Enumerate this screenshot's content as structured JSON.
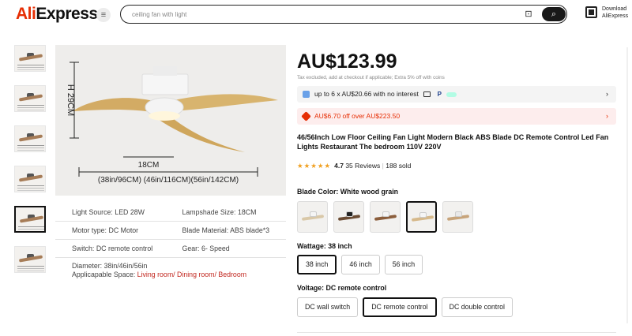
{
  "header": {
    "logo_ali": "Ali",
    "logo_express": "Express",
    "search_value": "ceiling fan with light",
    "download_line1": "Download",
    "download_line2": "AliExpress"
  },
  "gallery": {
    "thumb_count": 6,
    "active_thumb": 5,
    "image_labels": {
      "height": "H 29CM",
      "width": "18CM",
      "sizes": "(38in/96CM) (46in/116CM)(56in/142CM)"
    }
  },
  "specs": {
    "rows": [
      {
        "a": "Light Source:",
        "av": "LED 28W",
        "b": "Lampshade Size:",
        "bv": "18CM"
      },
      {
        "a": "Motor type:",
        "av": "DC Motor",
        "b": "Blade Material:",
        "bv": "ABS blade*3"
      },
      {
        "a": "Switch:",
        "av": "DC remote control",
        "b": "Gear:",
        "bv": "6- Speed"
      }
    ],
    "diameter_label": "Diameter:",
    "diameter_value": "38in/46in/56in",
    "space_label": "Applicapable Space:",
    "space_value": "Living room/ Dining room/ Bedroom"
  },
  "product": {
    "price": "AU$123.99",
    "tax_note": "Tax excluded, add at checkout if applicable; Extra 5% off with coins",
    "installments": "up to 6 x AU$20.66 with no interest",
    "discount": "AU$6.70 off over AU$223.50",
    "title": "46/56Inch Low Floor Ceiling Fan Light Modern Black ABS Blade DC Remote Control Led Fan Lights Restaurant The bedroom 110V 220V",
    "stars": "★★★★★",
    "rating": "4.7",
    "reviews": "35 Reviews",
    "sold": "188 sold",
    "blade_color_label": "Blade Color: White wood grain",
    "blade_swatches": [
      {
        "blade": "#d9c8a8",
        "hub": "#f5f5f5"
      },
      {
        "blade": "#6b4c34",
        "hub": "#222222"
      },
      {
        "blade": "#8b5e3c",
        "hub": "#f5f5f5"
      },
      {
        "blade": "#d6b98b",
        "hub": "#f5f5f5"
      },
      {
        "blade": "#c7a47b",
        "hub": "#e9e9e9"
      }
    ],
    "selected_swatch": 3,
    "wattage_label": "Wattage: 38 inch",
    "wattage_options": [
      "38 inch",
      "46 inch",
      "56 inch"
    ],
    "voltage_label": "Voltage: DC remote control",
    "voltage_options": [
      "DC wall switch",
      "DC remote control",
      "DC double control"
    ]
  },
  "colors": {
    "brand_red": "#e62e04",
    "star": "#f0a020",
    "promo_bg": "#fdeded"
  }
}
